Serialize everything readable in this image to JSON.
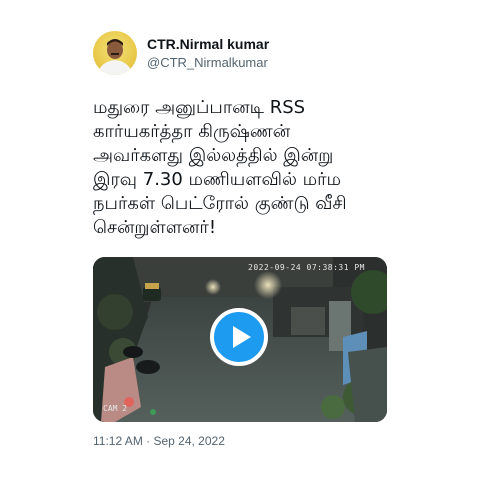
{
  "author": {
    "display_name": "CTR.Nirmal kumar",
    "handle": "@CTR_Nirmalkumar"
  },
  "tweet": {
    "text": "மதுரை அனுப்பானடி RSS\nகார்யகர்த்தா கிருஷ்ணன்\nஅவர்களது இல்லத்தில் இன்று\nஇரவு 7.30 மணியளவில் மர்ம\nநபர்கள் பெட்ரோல் குண்டு வீசி\nசென்றுள்ளனர்!",
    "posted_at": "11:12 AM · Sep 24, 2022"
  },
  "video": {
    "overlay_timestamp": "2022-09-24 07:38:31 PM",
    "camera_label": "CAM 2",
    "play_icon": "play-icon"
  },
  "colors": {
    "accent": "#1d9bf0",
    "secondary_text": "#536471",
    "primary_text": "#0f1419"
  }
}
